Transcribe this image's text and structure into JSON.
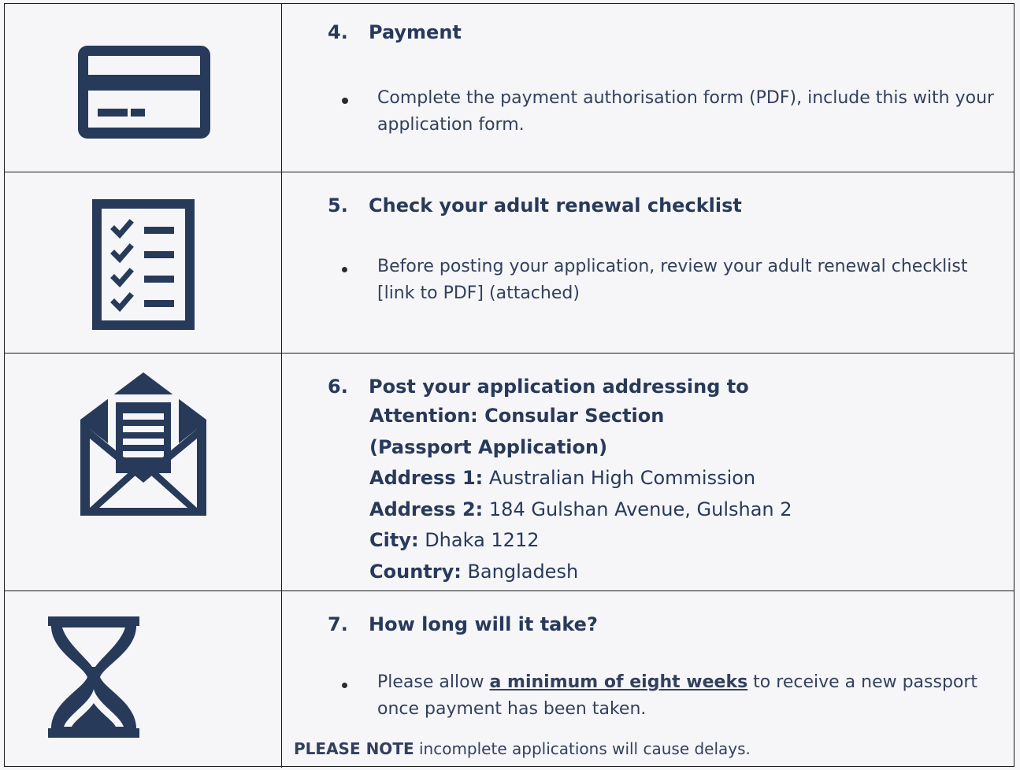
{
  "steps": [
    {
      "number": "4.",
      "title": "Payment",
      "icon": "credit-card-icon",
      "bullet": "Complete the payment authorisation form (PDF), include this with your application form."
    },
    {
      "number": "5.",
      "title": "Check your adult renewal checklist",
      "icon": "checklist-icon",
      "bullet": "Before posting your application, review your adult renewal checklist [link to PDF] (attached)"
    },
    {
      "number": "6.",
      "title": "Post your application addressing to",
      "icon": "open-envelope-icon",
      "attention_1": "Attention: Consular Section",
      "attention_2": "(Passport Application)",
      "address1_label": "Address 1:",
      "address1_value": " Australian High Commission",
      "address2_label": "Address 2:",
      "address2_value": " 184 Gulshan Avenue, Gulshan 2",
      "city_label": "City:",
      "city_value": " Dhaka 1212",
      "country_label": "Country:",
      "country_value": " Bangladesh"
    },
    {
      "number": "7.",
      "title": "How long will it take?",
      "icon": "hourglass-icon",
      "bullet_before": "Please allow ",
      "bullet_emphasis": "a minimum of eight weeks",
      "bullet_after": " to receive a new passport once payment has been taken.",
      "note_label": "PLEASE NOTE",
      "note_text": " incomplete applications will cause delays."
    }
  ],
  "colors": {
    "icon": "#283a5a",
    "background": "#f6f6f9",
    "border": "#1a1a1a"
  }
}
